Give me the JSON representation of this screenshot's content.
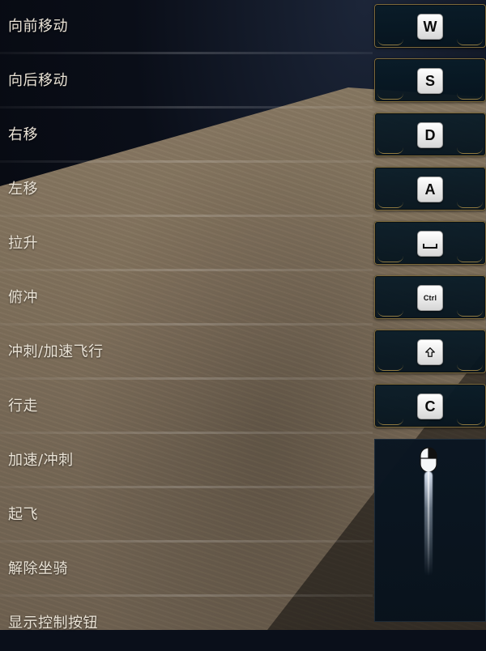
{
  "controls": [
    {
      "id": "forward",
      "label": "向前移动",
      "key_display": "W",
      "key_type": "letter"
    },
    {
      "id": "backward",
      "label": "向后移动",
      "key_display": "S",
      "key_type": "letter"
    },
    {
      "id": "right",
      "label": "右移",
      "key_display": "D",
      "key_type": "letter"
    },
    {
      "id": "left",
      "label": "左移",
      "key_display": "A",
      "key_type": "letter"
    },
    {
      "id": "ascend",
      "label": "拉升",
      "key_display": "",
      "key_type": "space",
      "key_icon": "space-bar-icon"
    },
    {
      "id": "dive",
      "label": "俯冲",
      "key_display": "Ctrl",
      "key_type": "text"
    },
    {
      "id": "sprint-fly",
      "label": "冲刺/加速飞行",
      "key_display": "",
      "key_type": "shift",
      "key_icon": "shift-arrow-icon"
    },
    {
      "id": "walk",
      "label": "行走",
      "key_display": "C",
      "key_type": "letter"
    },
    {
      "id": "boost-sprint",
      "label": "加速/冲刺",
      "key_display": "",
      "key_type": "mouse",
      "key_icon": "mouse-right-button-icon"
    },
    {
      "id": "takeoff",
      "label": "起飞",
      "key_display": "",
      "key_type": "none"
    },
    {
      "id": "dismount",
      "label": "解除坐骑",
      "key_display": "",
      "key_type": "none"
    },
    {
      "id": "show-controls",
      "label": "显示控制按钮",
      "key_display": "",
      "key_type": "none"
    }
  ],
  "colors": {
    "label_text": "#eae3d6",
    "key_bg": "#081a28",
    "key_border": "#8a7440",
    "keycap_bg": "#ffffff",
    "keycap_text": "#0a0a0a",
    "beam": "#e6f0ff"
  }
}
